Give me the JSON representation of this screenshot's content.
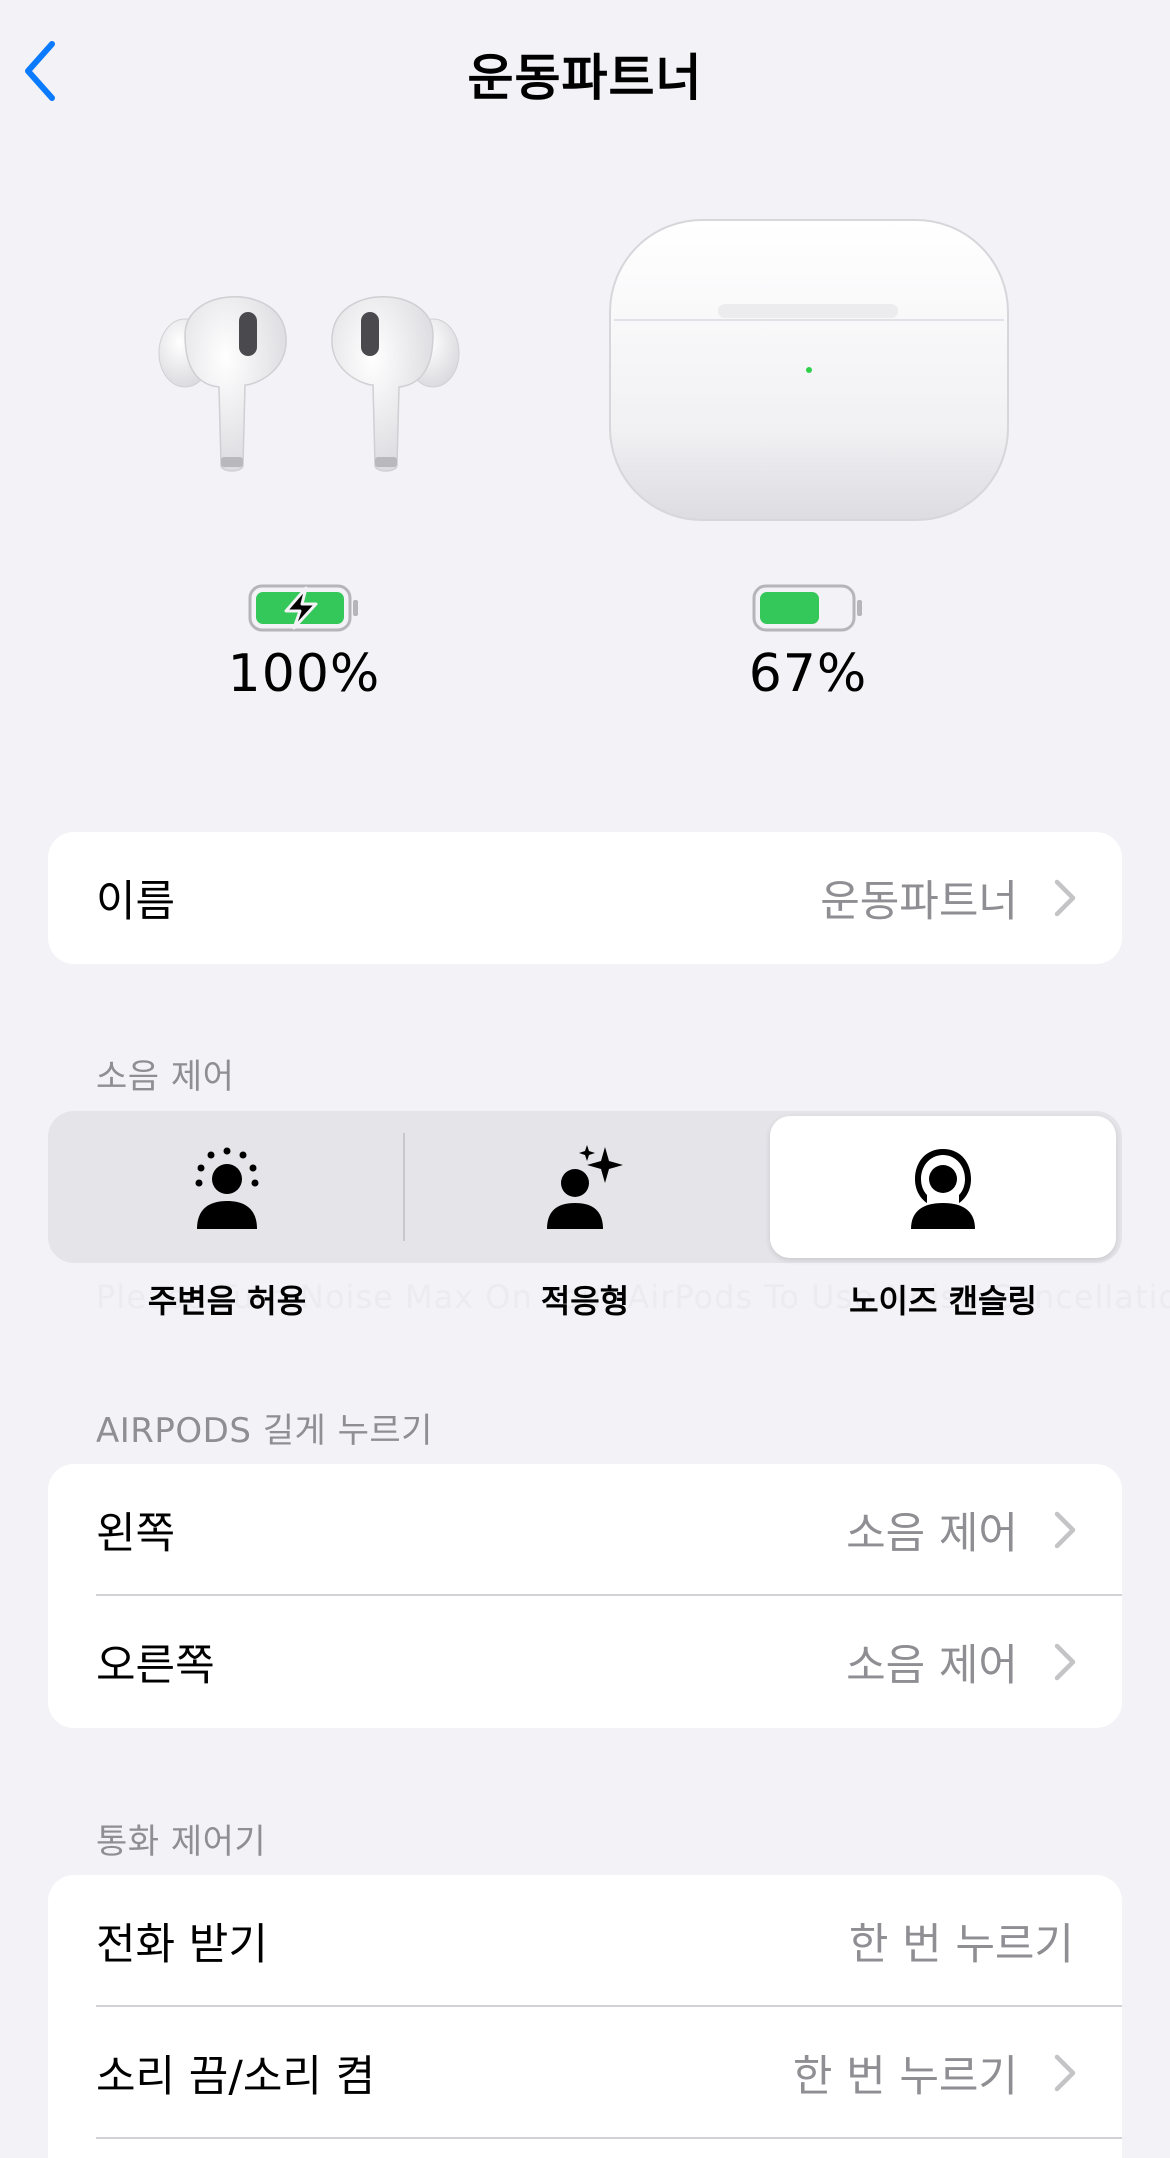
{
  "nav": {
    "back_icon": "chevron-left-icon",
    "title": "운동파트너"
  },
  "devices": {
    "earbuds": {
      "battery_percent": "100%",
      "charging": true,
      "battery_level": 1.0
    },
    "case": {
      "battery_percent": "67%",
      "charging": false,
      "battery_level": 0.67
    }
  },
  "name_row": {
    "label": "이름",
    "value": "운동파트너"
  },
  "noise_control": {
    "header": "소음 제어",
    "options": [
      {
        "label": "주변음 허용",
        "icon": "transparency-person-icon"
      },
      {
        "label": "적응형",
        "icon": "adaptive-person-sparkle-icon"
      },
      {
        "label": "노이즈 캔슬링",
        "icon": "noise-cancel-person-icon"
      }
    ],
    "selected_index": 2,
    "background_hint": "Please Turn Noise Max On Your AirPods To Use Noise Cancellation."
  },
  "press_hold": {
    "header": "AIRPODS 길게 누르기",
    "rows": [
      {
        "label": "왼쪽",
        "value": "소음 제어"
      },
      {
        "label": "오른쪽",
        "value": "소음 제어"
      }
    ]
  },
  "call_controls": {
    "header": "통화 제어기",
    "rows": [
      {
        "label": "전화 받기",
        "value": "한 번 누르기"
      },
      {
        "label": "소리 끔/소리 켬",
        "value": "한 번 누르기"
      }
    ]
  },
  "colors": {
    "accent": "#0a7aff",
    "battery_green": "#34c759",
    "secondary_text": "#8e8e93",
    "background": "#f2f2f7"
  }
}
